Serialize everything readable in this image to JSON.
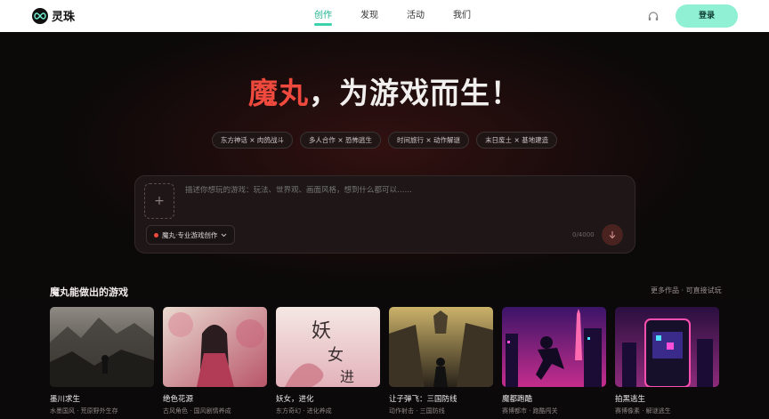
{
  "header": {
    "logo_text": "灵珠",
    "nav": [
      "创作",
      "发现",
      "活动",
      "我们"
    ],
    "active_nav": 0,
    "login_label": "登录"
  },
  "hero": {
    "headline_accent": "魔丸",
    "headline_rest": "，为游戏而生！",
    "chips": [
      "东方神话 × 肉鸽战斗",
      "多人合作 × 恐怖逃生",
      "时间旅行 × 动作解谜",
      "末日废土 × 基地建造"
    ]
  },
  "composer": {
    "placeholder": "描述你想玩的游戏：玩法、世界观、画面风格，想到什么都可以……",
    "upload_symbol": "+",
    "mode_label": "魔丸·专业游戏创作",
    "counter": "0/4000"
  },
  "showcase": {
    "title": "魔丸能做出的游戏",
    "link": "更多作品 · 可直接试玩",
    "cards": [
      {
        "title": "墨川求生",
        "subtitle": "水墨国风 · 荒原野外生存"
      },
      {
        "title": "绝色花源",
        "subtitle": "古风角色 · 国风剧情养成"
      },
      {
        "title": "妖女，进化",
        "subtitle": "东方奇幻 · 进化养成"
      },
      {
        "title": "让子弹飞：三国防线",
        "subtitle": "动作射击 · 三国防线"
      },
      {
        "title": "魔都跑酷",
        "subtitle": "赛博都市 · 跑酷闯关"
      },
      {
        "title": "拍黑逃生",
        "subtitle": "赛博像素 · 解谜逃生"
      }
    ]
  },
  "colors": {
    "accent_red": "#ef4a3d",
    "brand_mint": "#8ff0d4",
    "active_green": "#19b28c"
  }
}
